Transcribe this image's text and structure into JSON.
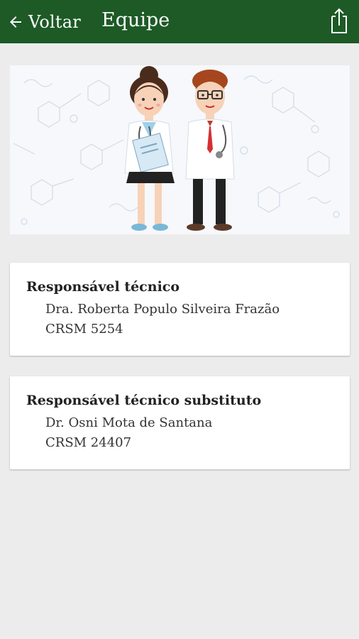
{
  "header": {
    "back_label": "Voltar",
    "title": "Equipe",
    "back_icon": "arrow-left-icon",
    "share_icon": "share-icon"
  },
  "colors": {
    "app_bar": "#1d5a26",
    "background": "#ececec",
    "card": "#ffffff"
  },
  "cards": [
    {
      "title": "Responsável técnico",
      "name": "Dra. Roberta Populo Silveira Frazão",
      "registry": "CRSM 5254"
    },
    {
      "title": "Responsável técnico substituto",
      "name": "Dr. Osni Mota de Santana",
      "registry": "CRSM 24407"
    }
  ]
}
